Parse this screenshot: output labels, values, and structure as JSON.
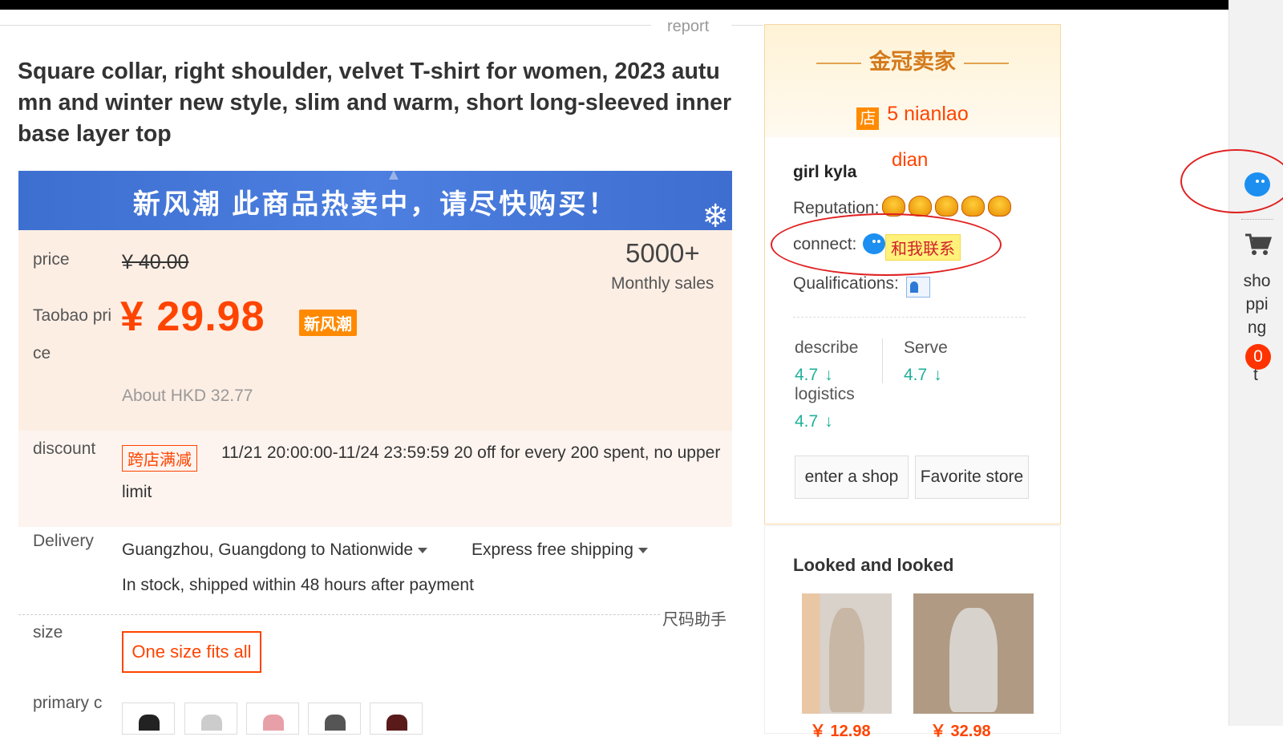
{
  "report_label": "report",
  "product": {
    "title": "Square collar, right shoulder, velvet T-shirt for women, 2023 autumn and winter new style, slim and warm, short long-sleeved inner base layer top"
  },
  "banner": {
    "text": "新风潮 此商品热卖中，请尽快购买！"
  },
  "price": {
    "label": "price",
    "original": "¥ 40.00",
    "taobao_label": "Taobao price",
    "current": "¥ 29.98",
    "tag": "新风潮",
    "sales_count": "5000+",
    "sales_label": "Monthly sales",
    "hkd": "About HKD 32.77"
  },
  "discount": {
    "label": "discount",
    "tag": "跨店满减",
    "text": "11/21 20:00:00-11/24 23:59:59 20 off for every 200 spent, no upper limit"
  },
  "delivery": {
    "label": "Delivery",
    "route": "Guangzhou, Guangdong to Nationwide",
    "shipping": "Express free shipping",
    "stock": "In stock, shipped within 48 hours after payment"
  },
  "size": {
    "helper": "尺码助手",
    "label": "size",
    "option": "One size fits all"
  },
  "color": {
    "label": "primary c"
  },
  "seller": {
    "badge": "金冠卖家",
    "shop_icon": "店",
    "shop_name": "5 nianlao",
    "owner": "girl kyla",
    "annotation": "dian",
    "reputation_label": "Reputation:",
    "connect_label": "connect:",
    "contact_tag": "和我联系",
    "qualifications_label": "Qualifications:",
    "scores": {
      "describe_label": "describe",
      "describe": "4.7",
      "serve_label": "Serve",
      "serve": "4.7",
      "logistics_label": "logistics",
      "logistics": "4.7",
      "trend_icon": "down-arrow-icon"
    },
    "enter_shop": "enter a shop",
    "favorite_store": "Favorite store"
  },
  "related": {
    "title": "Looked and looked",
    "items": [
      {
        "price": "￥ 12.98"
      },
      {
        "price": "￥ 32.98"
      }
    ]
  },
  "sidebar": {
    "cart_label": "shopping",
    "cart_lines": [
      "sho",
      "ppi",
      "ng"
    ],
    "cart_tail": "t",
    "cart_count": "0"
  },
  "colors": {
    "accent": "#ff4400",
    "banner": "#4c7fe0",
    "score": "#20b09a",
    "annotation": "#e02020"
  }
}
